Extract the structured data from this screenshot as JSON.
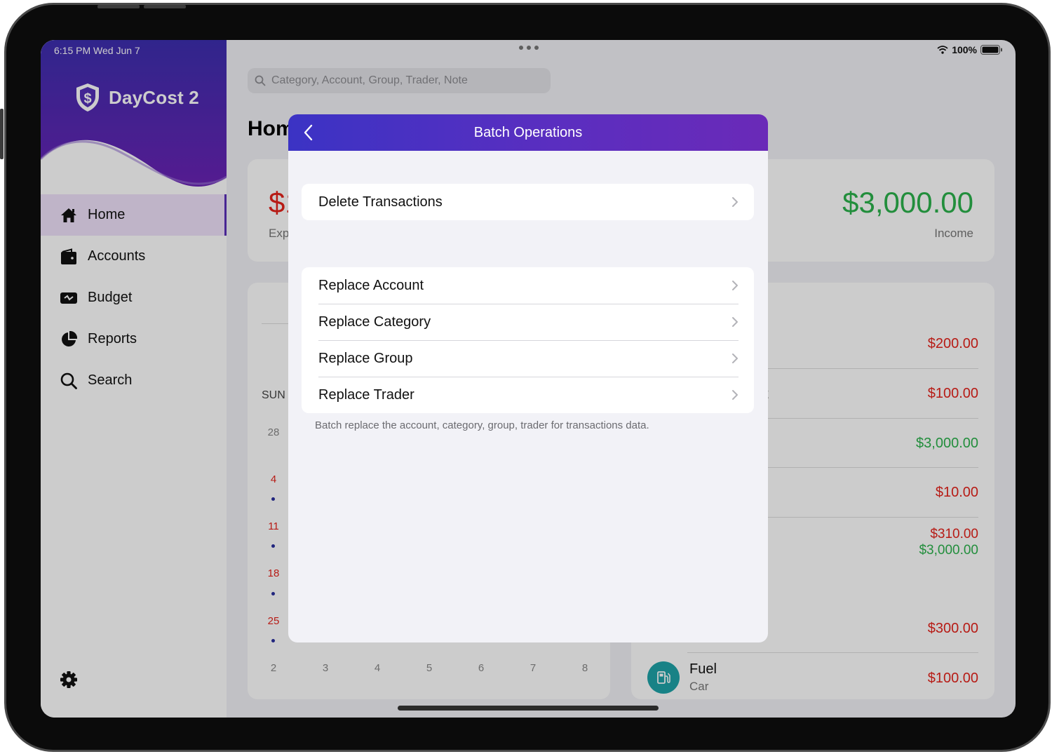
{
  "status_bar": {
    "time": "6:15 PM   Wed Jun 7",
    "battery": "100%"
  },
  "app": {
    "name": "DayCost 2"
  },
  "sidebar": {
    "items": [
      {
        "label": "Home",
        "icon": "house-icon",
        "active": true
      },
      {
        "label": "Accounts",
        "icon": "wallet-icon"
      },
      {
        "label": "Budget",
        "icon": "budget-icon"
      },
      {
        "label": "Reports",
        "icon": "pie-chart-icon"
      },
      {
        "label": "Search",
        "icon": "magnifier-icon"
      }
    ],
    "settings_icon": "gear-icon"
  },
  "search": {
    "placeholder": "Category, Account, Group, Trader, Note"
  },
  "main": {
    "title_partial": "Hom",
    "summary": {
      "expense_partial": "$1",
      "expense_label_partial": "Exp",
      "income_value": "$3,000.00",
      "income_label": "Income"
    },
    "calendar": {
      "weekday_first": "SUN",
      "rows": [
        "28",
        "4",
        "11",
        "18",
        "25"
      ],
      "next_row": [
        "2",
        "3",
        "4",
        "5",
        "6",
        "7",
        "8"
      ]
    },
    "transactions": {
      "amounts": [
        "$200.00",
        "$100.00",
        "$3,000.00",
        "$10.00",
        "$310.00",
        "$3,000.00",
        "$300.00",
        "$100.00"
      ],
      "partial_text": "t",
      "last_item": {
        "name": "Fuel",
        "sub": "Car",
        "icon": "fuel-pump-icon"
      }
    }
  },
  "modal": {
    "title": "Batch Operations",
    "back_icon": "chevron-left-icon",
    "group1": [
      {
        "label": "Delete Transactions"
      }
    ],
    "group2": [
      {
        "label": "Replace Account"
      },
      {
        "label": "Replace Category"
      },
      {
        "label": "Replace Group"
      },
      {
        "label": "Replace Trader"
      }
    ],
    "footnote": "Batch replace the account, category, group, trader for transactions data."
  },
  "colors": {
    "accent_purple": "#5a2fb8",
    "expense_red": "#e5221b",
    "income_green": "#2bb24c",
    "header_gradient_start": "#3b33c4",
    "header_gradient_end": "#6a2ab8"
  }
}
